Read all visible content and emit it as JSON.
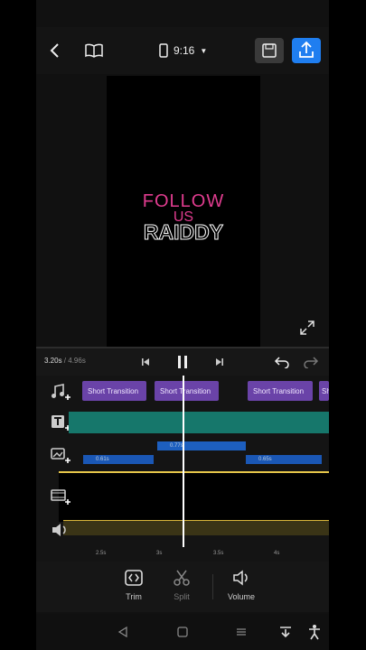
{
  "header": {
    "back_icon": "chevron-left-icon",
    "guide_icon": "book-icon",
    "aspect_ratio": "9:16",
    "save_icon": "save-icon",
    "export_icon": "export-icon"
  },
  "preview": {
    "title_line1": "FOLLOW",
    "title_line2": "US",
    "title_line3": "RAIDDY"
  },
  "playback": {
    "current_time": "3.20s",
    "total_time": "4.96s",
    "separator": " / "
  },
  "timeline": {
    "music_clips": [
      {
        "label": "Short Transition"
      },
      {
        "label": "Short Transition"
      },
      {
        "label": "Short Transition"
      },
      {
        "label": "Sh"
      }
    ],
    "overlay_clips": [
      {
        "label": "0.61s"
      },
      {
        "label": "0.77s"
      },
      {
        "label": "0.65s"
      }
    ],
    "ruler_ticks": [
      "2.5s",
      "3s",
      "3.5s",
      "4s"
    ]
  },
  "tools": [
    {
      "label": "Trim",
      "icon": "trim-icon"
    },
    {
      "label": "Split",
      "icon": "scissors-icon"
    },
    {
      "label": "Volume",
      "icon": "volume-icon"
    }
  ],
  "colors": {
    "accent": "#1f7ef0",
    "clip_purple": "#6a43a8",
    "text_pink": "#e03c8f",
    "track_teal": "#16776b",
    "audio_yellow": "#e6c64a"
  }
}
